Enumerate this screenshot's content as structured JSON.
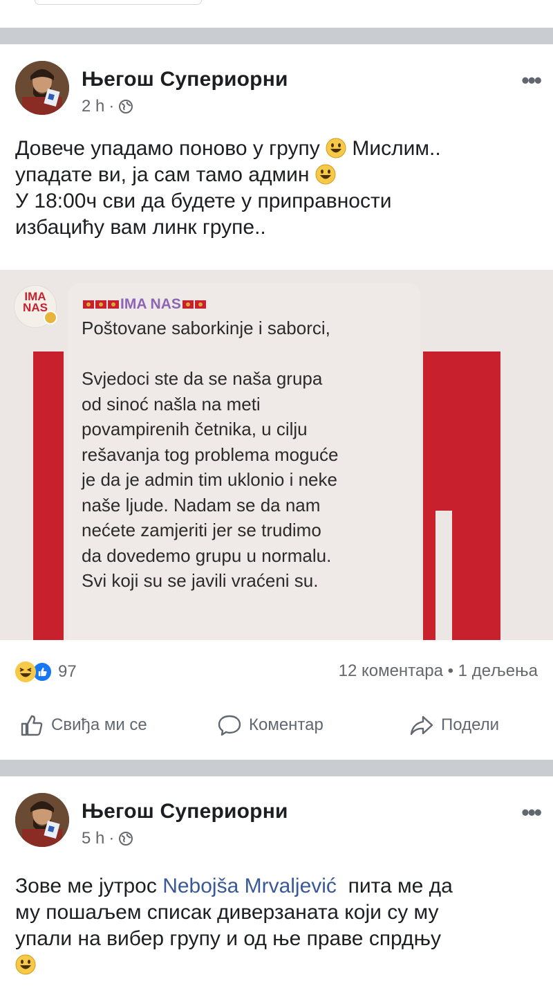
{
  "posts": [
    {
      "author": "Његош Супериорни",
      "time": "2 h",
      "more": "•••",
      "text_lines": [
        "Довече упадамо поново у групу",
        "Мислим..",
        "упадате ви, ја сам тамо админ",
        "У 18:00ч сви да будете у приправности",
        "избацићу вам линк групе.."
      ],
      "image": {
        "logo_line1": "IMA",
        "logo_line2": "NAS",
        "bubble_title": "IMA NAS",
        "bubble_text": "Poštovane saborkinje i saborci,\n\nSvjedoci ste da se naša grupa\nod sinoć našla na meti\npovampirenih četnika, u cilju\nrešavanja tog problema moguće\nje da je admin tim uklonio i neke\nnaše ljude. Nadam se da nam\nnećete zamjeriti jer se trudimo\nda dovedemo grupu u normalu.\nSvi koji su se javili vraćeni su."
      },
      "stats": {
        "reactions": "97",
        "comments_shares": "12 коментара • 1 дељења"
      },
      "actions": {
        "like": "Свиђа ми се",
        "comment": "Коментар",
        "share": "Подели"
      }
    },
    {
      "author": "Његош Супериорни",
      "time": "5 h",
      "more": "•••",
      "text_before_mention": "Зове ме јутрос ",
      "mention": "Nebojša Mrvaljević",
      "text_after_mention": "  пита ме да",
      "text_lines": [
        "му пошаљем списак диверзаната који су му",
        "упали на вибер групу и од ње праве спрдњу"
      ]
    }
  ],
  "colors": {
    "mention": "#385898",
    "divider": "#c9ccd1",
    "flag_red": "#c8202c"
  },
  "icons": [
    "globe-icon",
    "more-icon",
    "smile-emoji-icon",
    "haha-reaction-icon",
    "like-reaction-icon",
    "like-icon",
    "comment-icon",
    "share-icon"
  ]
}
